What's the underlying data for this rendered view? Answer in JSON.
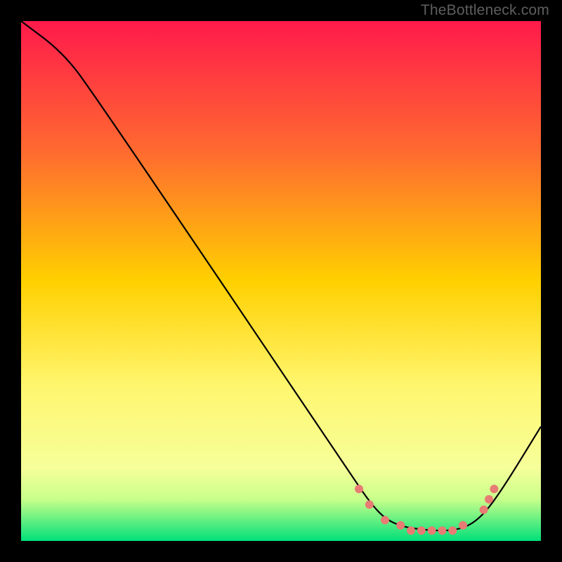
{
  "attribution": "TheBottleneck.com",
  "chart_data": {
    "type": "line",
    "title": "",
    "xlabel": "",
    "ylabel": "",
    "xlim": [
      0,
      100
    ],
    "ylim": [
      0,
      100
    ],
    "background_gradient": {
      "stops": [
        {
          "offset": 0,
          "color": "#FF1A4B"
        },
        {
          "offset": 25,
          "color": "#FF6A30"
        },
        {
          "offset": 50,
          "color": "#FFD000"
        },
        {
          "offset": 70,
          "color": "#FFF66E"
        },
        {
          "offset": 86,
          "color": "#F6FF9A"
        },
        {
          "offset": 92,
          "color": "#C8FF8A"
        },
        {
          "offset": 100,
          "color": "#00E07A"
        }
      ]
    },
    "curve": {
      "comment": "x runs 0..100 left-to-right, y runs 0..100 bottom-to-top. Curve is a benchmark bottleneck valley.",
      "points": [
        {
          "x": 0,
          "y": 100
        },
        {
          "x": 8,
          "y": 94
        },
        {
          "x": 14,
          "y": 86
        },
        {
          "x": 62,
          "y": 15
        },
        {
          "x": 68,
          "y": 6
        },
        {
          "x": 72,
          "y": 3
        },
        {
          "x": 78,
          "y": 2
        },
        {
          "x": 84,
          "y": 2
        },
        {
          "x": 88,
          "y": 4
        },
        {
          "x": 92,
          "y": 9
        },
        {
          "x": 100,
          "y": 22
        }
      ]
    },
    "markers": {
      "comment": "Salmon dotted markers along the valley floor segment of the curve",
      "color": "#E87B73",
      "radius_px": 6,
      "points": [
        {
          "x": 65,
          "y": 10
        },
        {
          "x": 67,
          "y": 7
        },
        {
          "x": 70,
          "y": 4
        },
        {
          "x": 73,
          "y": 3
        },
        {
          "x": 75,
          "y": 2
        },
        {
          "x": 77,
          "y": 2
        },
        {
          "x": 79,
          "y": 2
        },
        {
          "x": 81,
          "y": 2
        },
        {
          "x": 83,
          "y": 2
        },
        {
          "x": 85,
          "y": 3
        },
        {
          "x": 89,
          "y": 6
        },
        {
          "x": 90,
          "y": 8
        },
        {
          "x": 91,
          "y": 10
        }
      ]
    }
  }
}
